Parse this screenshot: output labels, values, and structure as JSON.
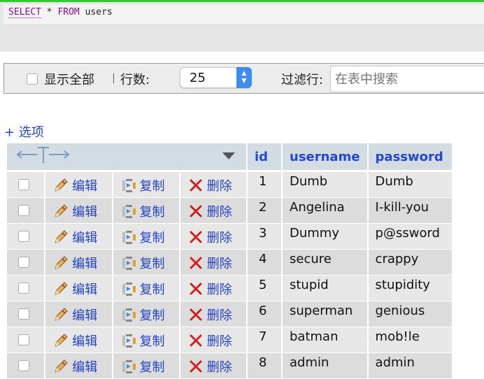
{
  "query": {
    "select_kw": "SELECT",
    "star": " * ",
    "from_kw": "FROM",
    "table_name": " users"
  },
  "filter_bar": {
    "show_all_label": "显示全部",
    "rows_label": "行数:",
    "rows_value": "25",
    "filter_label": "过滤行:",
    "search_placeholder": "在表中搜索"
  },
  "options_link": "+ 选项",
  "table": {
    "columns": [
      "id",
      "username",
      "password"
    ],
    "actions": {
      "edit": "编辑",
      "copy": "复制",
      "delete": "删除"
    },
    "rows": [
      {
        "id": "1",
        "username": "Dumb",
        "password": "Dumb"
      },
      {
        "id": "2",
        "username": "Angelina",
        "password": "I-kill-you"
      },
      {
        "id": "3",
        "username": "Dummy",
        "password": "p@ssword"
      },
      {
        "id": "4",
        "username": "secure",
        "password": "crappy"
      },
      {
        "id": "5",
        "username": "stupid",
        "password": "stupidity"
      },
      {
        "id": "6",
        "username": "superman",
        "password": "genious"
      },
      {
        "id": "7",
        "username": "batman",
        "password": "mob!le"
      },
      {
        "id": "8",
        "username": "admin",
        "password": "admin"
      }
    ]
  },
  "colors": {
    "link": "#2343c8",
    "header_bg": "#d3dce3",
    "keyword": "#8b0d8b",
    "focus_border": "#2ecc2e"
  }
}
